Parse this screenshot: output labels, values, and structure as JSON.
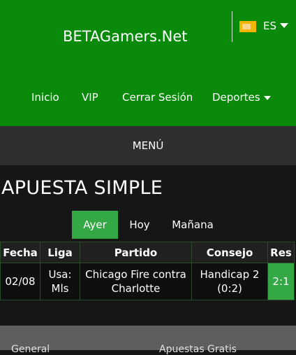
{
  "header": {
    "site_title": "BETAGamers.Net",
    "language": "ES",
    "flag_icon": "spain-flag-icon"
  },
  "nav": {
    "items": [
      {
        "label": "Inicio"
      },
      {
        "label": "VIP"
      },
      {
        "label": "Cerrar Sesión"
      },
      {
        "label": "Deportes",
        "icon": "caret-down-icon"
      }
    ]
  },
  "menu": {
    "label": "MENÚ"
  },
  "section": {
    "title": "APUESTA SIMPLE"
  },
  "tabs": {
    "items": [
      {
        "label": "Ayer",
        "active": true
      },
      {
        "label": "Hoy",
        "active": false
      },
      {
        "label": "Mañana",
        "active": false
      }
    ]
  },
  "table": {
    "headers": [
      "Fecha",
      "Liga",
      "Partido",
      "Consejo",
      "Res"
    ],
    "rows": [
      {
        "fecha": "02/08",
        "liga_line1": "Usa:",
        "liga_line2": "Mls",
        "partido_line1": "Chicago Fire contra",
        "partido_line2": "Charlotte",
        "consejo_line1": "Handicap 2",
        "consejo_line2": "(0:2)",
        "res": "2:1"
      }
    ]
  },
  "footer": {
    "links": [
      "General",
      "Apuestas Gratis"
    ]
  },
  "colors": {
    "header_green": "#0a8a0a",
    "active_tab": "#33a845",
    "result_cell": "#33a845",
    "menu_bar": "#2f2f2f",
    "footer": "#5e5e5e"
  }
}
